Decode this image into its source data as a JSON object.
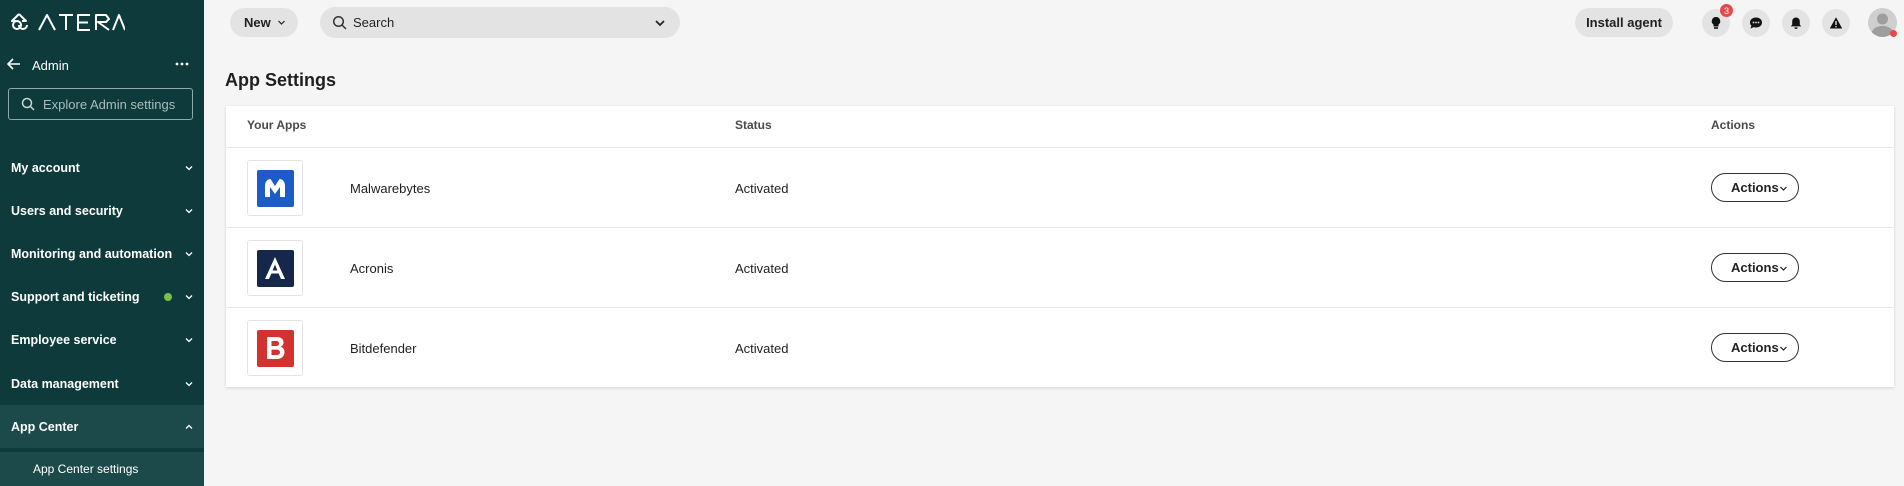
{
  "brand": {
    "logo_text": "ATERA",
    "accent": "#0e3a3b"
  },
  "sidebar": {
    "back_label": "Admin",
    "search_placeholder": "Explore Admin settings",
    "items": [
      {
        "label": "My account"
      },
      {
        "label": "Users and security"
      },
      {
        "label": "Monitoring and automation"
      },
      {
        "label": "Support and ticketing",
        "status_dot": "#7cc043"
      },
      {
        "label": "Employee service"
      },
      {
        "label": "Data management"
      },
      {
        "label": "App Center",
        "expanded": true
      }
    ],
    "sub_items": [
      {
        "label": "App Center settings"
      }
    ]
  },
  "header": {
    "new_label": "New",
    "search_placeholder": "Search",
    "install_label": "Install agent",
    "icons": [
      {
        "name": "lightbulb-icon",
        "badge": "3"
      },
      {
        "name": "chat-icon"
      },
      {
        "name": "bell-icon"
      },
      {
        "name": "warning-icon"
      }
    ]
  },
  "main": {
    "title": "App Settings",
    "columns": {
      "apps": "Your Apps",
      "status": "Status",
      "actions": "Actions"
    },
    "rows": [
      {
        "name": "Malwarebytes",
        "status": "Activated",
        "action_label": "Actions",
        "logo_color": "#1c5bc8",
        "logo_icon": "malwarebytes-logo"
      },
      {
        "name": "Acronis",
        "status": "Activated",
        "action_label": "Actions",
        "logo_color": "#15274a",
        "logo_icon": "acronis-logo"
      },
      {
        "name": "Bitdefender",
        "status": "Activated",
        "action_label": "Actions",
        "logo_color": "#d2332f",
        "logo_icon": "bitdefender-logo"
      }
    ]
  }
}
